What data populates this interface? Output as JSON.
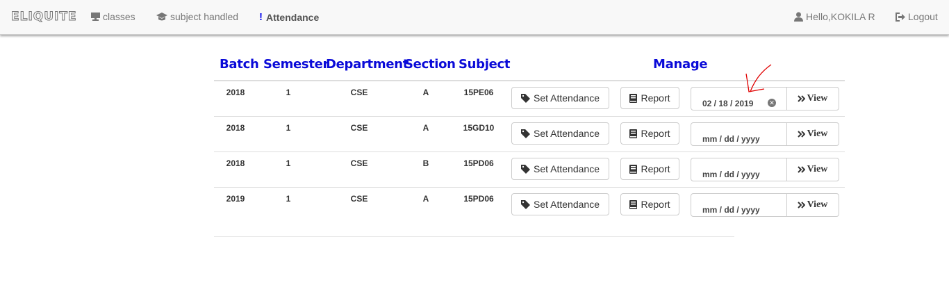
{
  "navbar": {
    "brand": "ELIQUITE",
    "items": [
      {
        "label": "classes",
        "icon": "monitor-icon"
      },
      {
        "label": "subject handled",
        "icon": "graduation-cap-icon"
      },
      {
        "label": "Attendance",
        "icon": "exclamation-icon",
        "active": true
      }
    ],
    "user_greeting": "Hello,KOKILA R",
    "logout_label": "Logout"
  },
  "table": {
    "headers": {
      "batch": "Batch",
      "semester": "Semester",
      "department": "Department",
      "section": "Section",
      "subject": "Subject",
      "manage": "Manage"
    },
    "rows": [
      {
        "batch": "2018",
        "semester": "1",
        "department": "CSE",
        "section": "A",
        "subject": "15PE06",
        "date": "02 / 18 / 2019"
      },
      {
        "batch": "2018",
        "semester": "1",
        "department": "CSE",
        "section": "A",
        "subject": "15GD10",
        "date": "mm / dd / yyyy"
      },
      {
        "batch": "2018",
        "semester": "1",
        "department": "CSE",
        "section": "B",
        "subject": "15PD06",
        "date": "mm / dd / yyyy"
      },
      {
        "batch": "2019",
        "semester": "1",
        "department": "CSE",
        "section": "A",
        "subject": "15PD06",
        "date": "mm / dd / yyyy"
      }
    ],
    "set_attendance_label": "Set Attendance",
    "report_label": "Report",
    "view_label": "View"
  },
  "colors": {
    "header_text": "#0a0ad8",
    "annotation_arrow": "#e00000"
  }
}
